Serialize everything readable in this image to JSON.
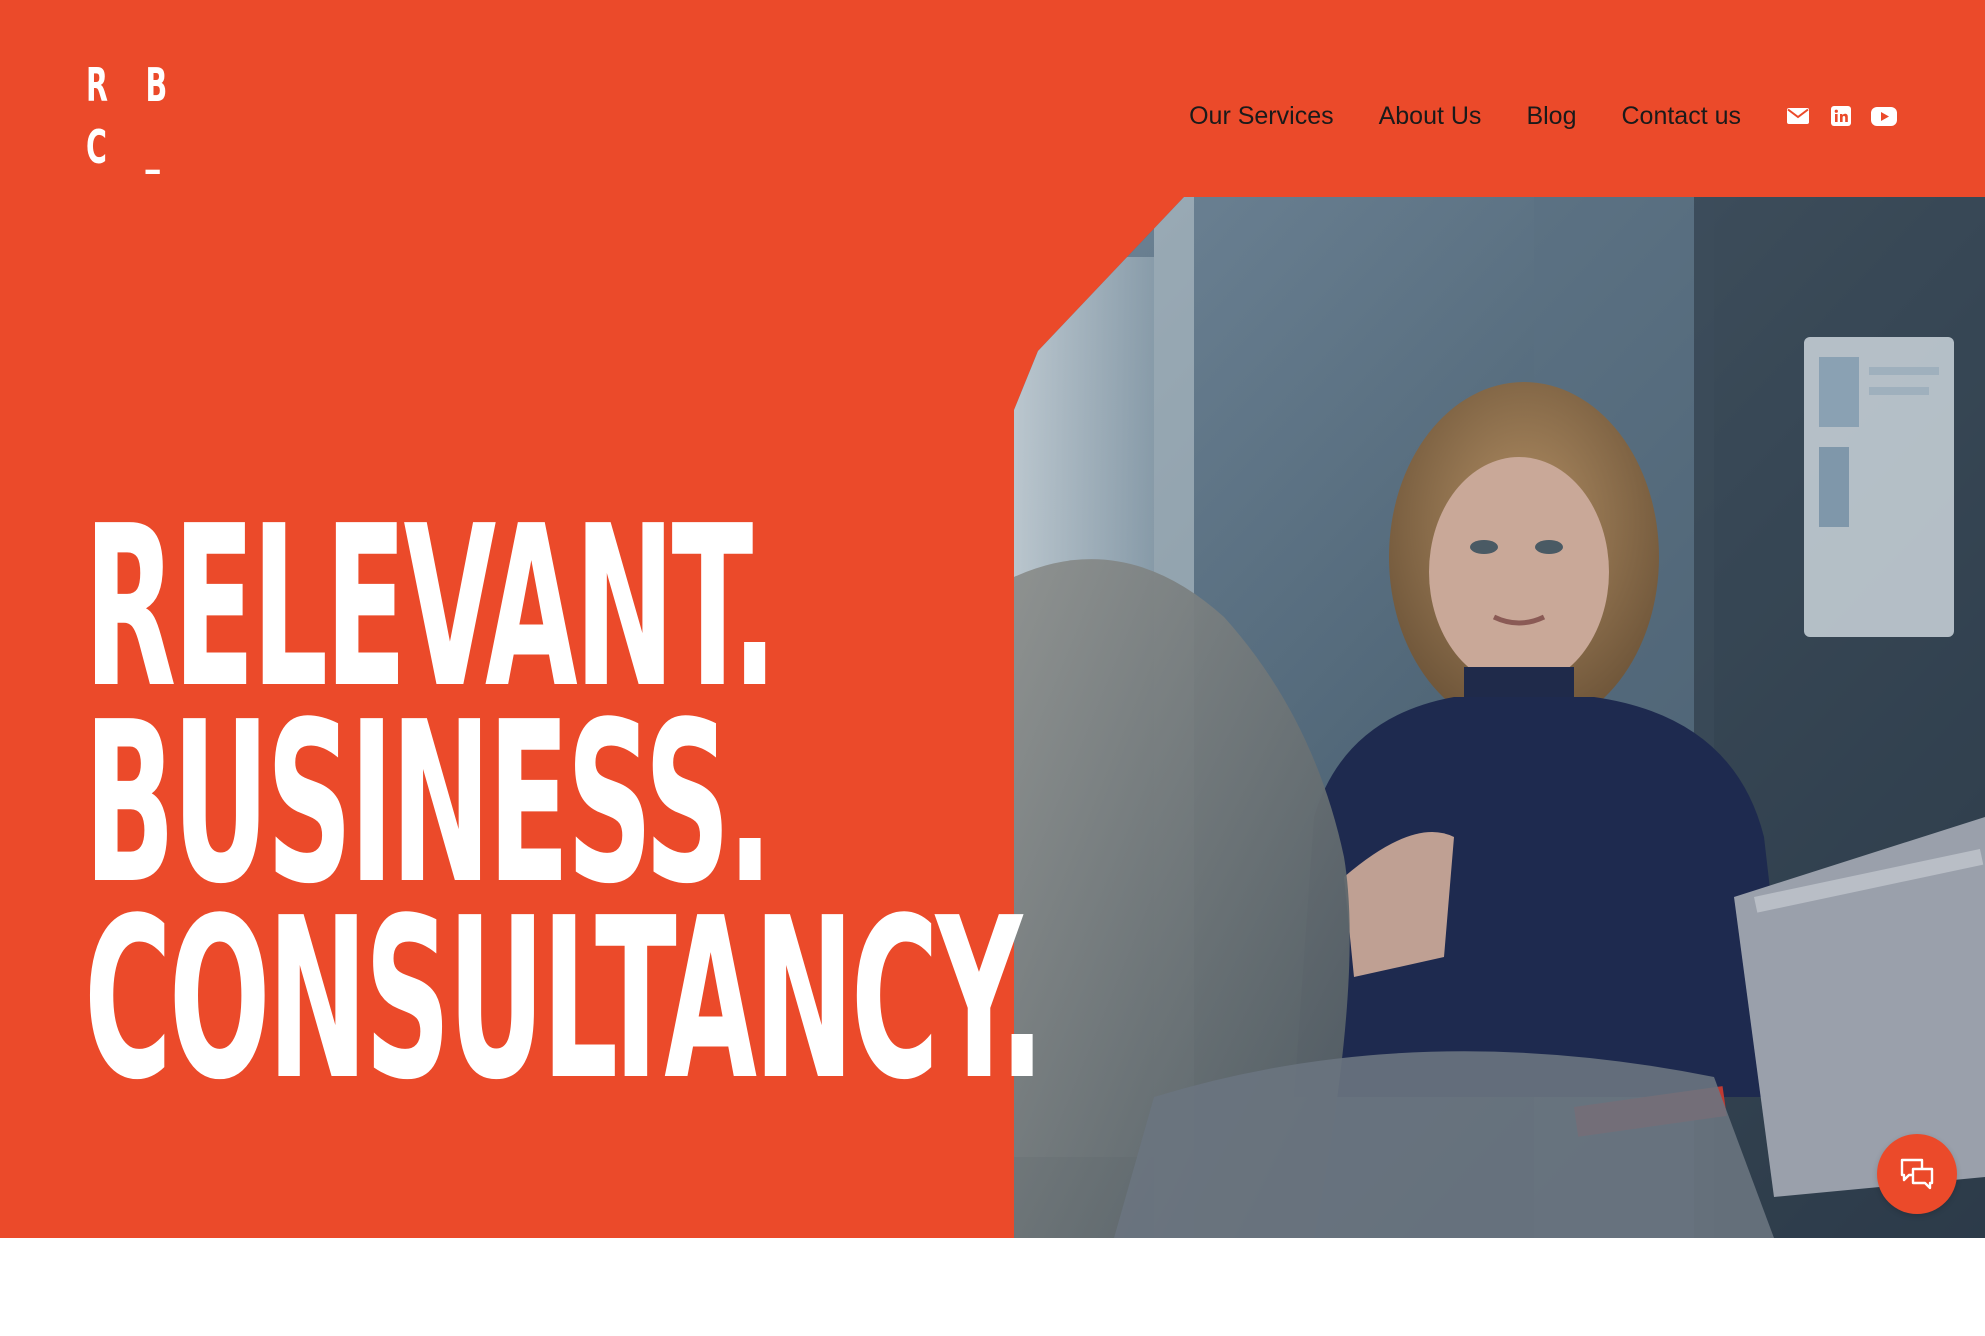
{
  "brand": {
    "logo_letters": [
      "R",
      "B",
      "C",
      "_"
    ],
    "accent_color": "#eb4a2a"
  },
  "nav": {
    "items": [
      {
        "label": "Our Services"
      },
      {
        "label": "About Us"
      },
      {
        "label": "Blog"
      },
      {
        "label": "Contact us"
      }
    ],
    "social_icons": [
      "email-icon",
      "linkedin-icon",
      "youtube-icon"
    ]
  },
  "hero": {
    "headline_lines": [
      "RELEVANT.",
      "BUSINESS.",
      "CONSULTANCY."
    ],
    "photo_icon": "meeting-photo"
  },
  "chat": {
    "icon": "chat-bubbles-icon"
  }
}
